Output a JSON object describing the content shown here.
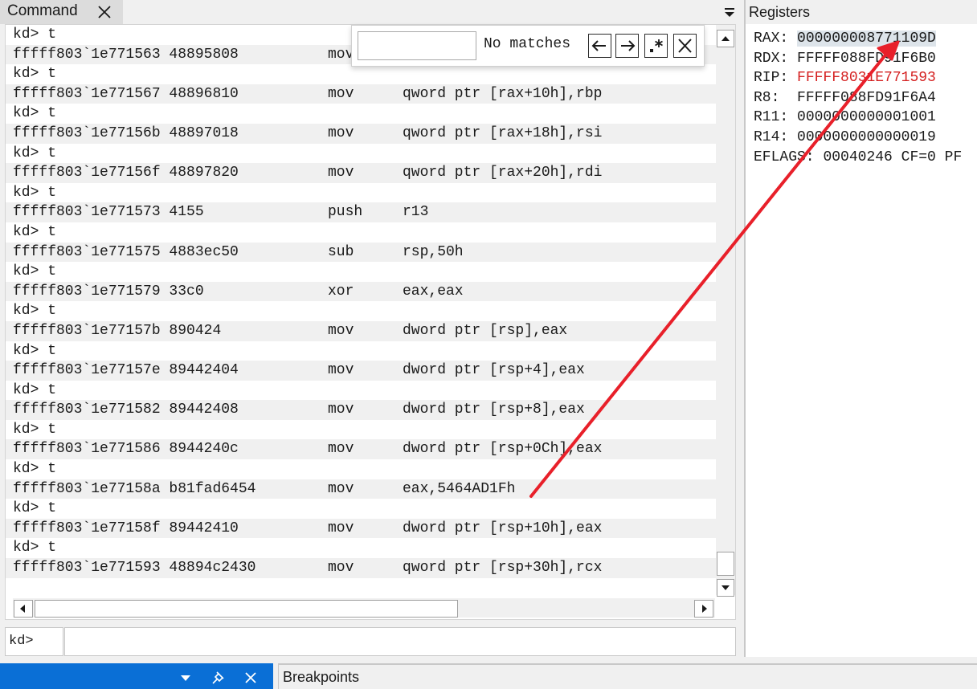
{
  "command_window": {
    "title": "Command",
    "output": [
      {
        "type": "prompt",
        "text": "kd> t"
      },
      {
        "type": "instr",
        "addr": "fffff803`1e771563 48895808",
        "op": "mov",
        "arg": ""
      },
      {
        "type": "prompt",
        "text": "kd> t"
      },
      {
        "type": "instr",
        "addr": "fffff803`1e771567 48896810",
        "op": "mov",
        "arg": "qword ptr [rax+10h],rbp"
      },
      {
        "type": "prompt",
        "text": "kd> t"
      },
      {
        "type": "instr",
        "addr": "fffff803`1e77156b 48897018",
        "op": "mov",
        "arg": "qword ptr [rax+18h],rsi"
      },
      {
        "type": "prompt",
        "text": "kd> t"
      },
      {
        "type": "instr",
        "addr": "fffff803`1e77156f 48897820",
        "op": "mov",
        "arg": "qword ptr [rax+20h],rdi"
      },
      {
        "type": "prompt",
        "text": "kd> t"
      },
      {
        "type": "instr",
        "addr": "fffff803`1e771573 4155",
        "op": "push",
        "arg": "r13"
      },
      {
        "type": "prompt",
        "text": "kd> t"
      },
      {
        "type": "instr",
        "addr": "fffff803`1e771575 4883ec50",
        "op": "sub",
        "arg": "rsp,50h"
      },
      {
        "type": "prompt",
        "text": "kd> t"
      },
      {
        "type": "instr",
        "addr": "fffff803`1e771579 33c0",
        "op": "xor",
        "arg": "eax,eax"
      },
      {
        "type": "prompt",
        "text": "kd> t"
      },
      {
        "type": "instr",
        "addr": "fffff803`1e77157b 890424",
        "op": "mov",
        "arg": "dword ptr [rsp],eax"
      },
      {
        "type": "prompt",
        "text": "kd> t"
      },
      {
        "type": "instr",
        "addr": "fffff803`1e77157e 89442404",
        "op": "mov",
        "arg": "dword ptr [rsp+4],eax"
      },
      {
        "type": "prompt",
        "text": "kd> t"
      },
      {
        "type": "instr",
        "addr": "fffff803`1e771582 89442408",
        "op": "mov",
        "arg": "dword ptr [rsp+8],eax"
      },
      {
        "type": "prompt",
        "text": "kd> t"
      },
      {
        "type": "instr",
        "addr": "fffff803`1e771586 8944240c",
        "op": "mov",
        "arg": "dword ptr [rsp+0Ch],eax"
      },
      {
        "type": "prompt",
        "text": "kd> t"
      },
      {
        "type": "instr",
        "addr": "fffff803`1e77158a b81fad6454",
        "op": "mov",
        "arg": "eax,5464AD1Fh"
      },
      {
        "type": "prompt",
        "text": "kd> t"
      },
      {
        "type": "instr",
        "addr": "fffff803`1e77158f 89442410",
        "op": "mov",
        "arg": "dword ptr [rsp+10h],eax"
      },
      {
        "type": "prompt",
        "text": "kd> t"
      },
      {
        "type": "instr",
        "addr": "fffff803`1e771593 48894c2430",
        "op": "mov",
        "arg": "qword ptr [rsp+30h],rcx"
      }
    ],
    "prompt_label": "kd>",
    "command_value": ""
  },
  "find_bar": {
    "query": "",
    "status": "No matches"
  },
  "registers_window": {
    "title": "Registers",
    "registers": [
      {
        "name": "RAX:",
        "value": "000000008771109D",
        "highlighted": true,
        "changed": false
      },
      {
        "name": "RDX:",
        "value": "FFFFF088FD91F6B0",
        "highlighted": false,
        "changed": false
      },
      {
        "name": "RIP:",
        "value": "FFFFF8031E771593",
        "highlighted": false,
        "changed": true
      },
      {
        "name": "R8: ",
        "value": "FFFFF088FD91F6A4",
        "highlighted": false,
        "changed": false
      },
      {
        "name": "R11:",
        "value": "0000000000001001",
        "highlighted": false,
        "changed": false
      },
      {
        "name": "R14:",
        "value": "0000000000000019",
        "highlighted": false,
        "changed": false
      },
      {
        "name": "EFLAGS:",
        "value": "00040246 CF=0 PF",
        "highlighted": false,
        "changed": false
      }
    ]
  },
  "breakpoints_window": {
    "title": "Breakpoints"
  },
  "colors": {
    "changed_register": "#d42020",
    "highlight": "#dde4ea",
    "annotation_arrow": "#e8202a",
    "active_panel": "#0a6fd6"
  },
  "icons": {
    "tab_close": "close-icon",
    "menu": "chevron-down-icon",
    "find_prev": "arrow-left-icon",
    "find_next": "arrow-right-icon",
    "find_regex": "regex-icon",
    "find_close": "close-icon",
    "pin": "pin-icon"
  }
}
